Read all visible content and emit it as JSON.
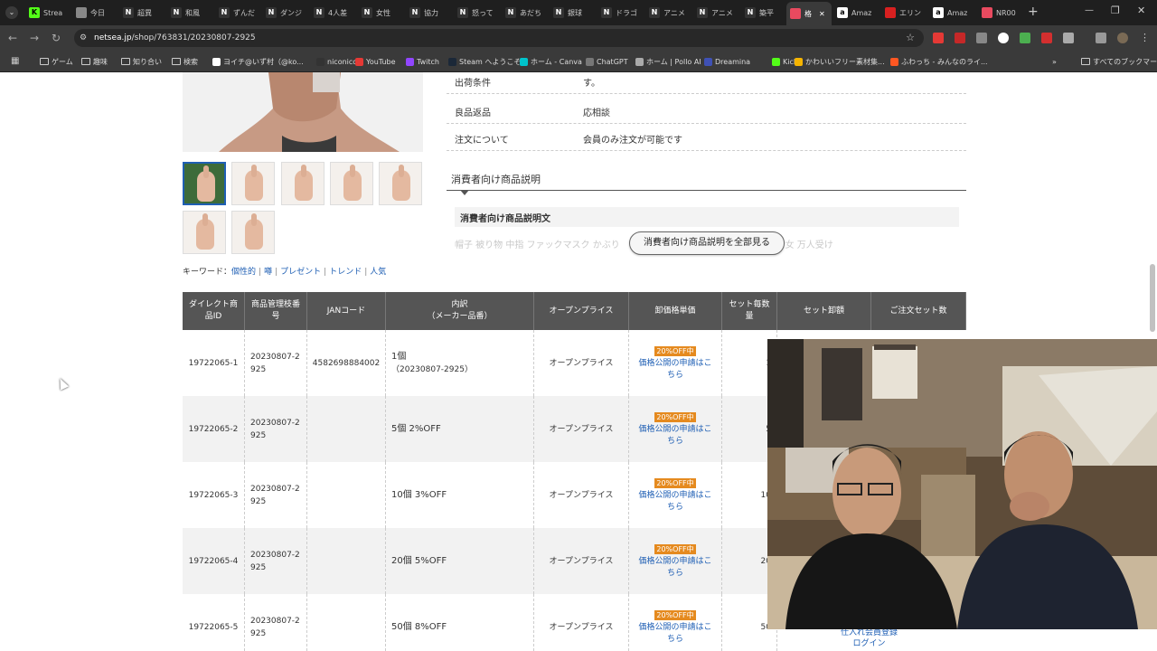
{
  "browser": {
    "tabs": [
      {
        "label": "Strea",
        "icon": "kick-icon",
        "color": "#53fc18"
      },
      {
        "label": "今日",
        "icon": "globe-icon",
        "color": "#888888"
      },
      {
        "label": "超異",
        "icon": "n-icon",
        "color": "#333333"
      },
      {
        "label": "和風",
        "icon": "n-icon",
        "color": "#333333"
      },
      {
        "label": "ずんだ",
        "icon": "n-icon",
        "color": "#333333"
      },
      {
        "label": "ダンジ",
        "icon": "n-icon",
        "color": "#333333"
      },
      {
        "label": "4人差",
        "icon": "n-icon",
        "color": "#333333"
      },
      {
        "label": "女性",
        "icon": "n-icon",
        "color": "#333333"
      },
      {
        "label": "協力",
        "icon": "n-icon",
        "color": "#333333"
      },
      {
        "label": "怒って",
        "icon": "n-icon",
        "color": "#333333"
      },
      {
        "label": "あだち",
        "icon": "n-icon",
        "color": "#333333"
      },
      {
        "label": "銀球",
        "icon": "n-icon",
        "color": "#333333"
      },
      {
        "label": "ドラゴ",
        "icon": "n-icon",
        "color": "#333333"
      },
      {
        "label": "アニメ",
        "icon": "n-icon",
        "color": "#333333"
      },
      {
        "label": "アニメ",
        "icon": "n-icon",
        "color": "#333333"
      },
      {
        "label": "築平",
        "icon": "n-icon",
        "color": "#333333"
      },
      {
        "label": "格",
        "icon": "chart-icon",
        "color": "#e84a5f",
        "active": true
      },
      {
        "label": "Amaz",
        "icon": "a-icon",
        "color": "#ffffff"
      },
      {
        "label": "エリン",
        "icon": "circle-icon",
        "color": "#d82020"
      },
      {
        "label": "Amaz",
        "icon": "a-icon",
        "color": "#ffffff"
      },
      {
        "label": "NR00",
        "icon": "nr-icon",
        "color": "#e84a5f"
      }
    ],
    "url": {
      "domain": "netsea.jp",
      "path": "/shop/763831/20230807-2925"
    },
    "bookmarks": [
      {
        "label": "ゲーム",
        "icon": "folder-icon"
      },
      {
        "label": "趣味",
        "icon": "folder-icon"
      },
      {
        "label": "知り合い",
        "icon": "folder-icon"
      },
      {
        "label": "検索",
        "icon": "folder-icon"
      },
      {
        "label": "ヨイチ@いず村（@ko...",
        "icon": "x-icon"
      },
      {
        "label": "niconico",
        "icon": "niconico-icon"
      },
      {
        "label": "YouTube",
        "icon": "youtube-icon"
      },
      {
        "label": "Twitch",
        "icon": "twitch-icon"
      },
      {
        "label": "Steam へようこそ",
        "icon": "steam-icon"
      },
      {
        "label": "ホーム - Canva",
        "icon": "canva-icon"
      },
      {
        "label": "ChatGPT",
        "icon": "chatgpt-icon"
      },
      {
        "label": "ホーム | Pollo AI",
        "icon": "pollo-icon"
      },
      {
        "label": "Dreamina",
        "icon": "dreamina-icon"
      },
      {
        "label": "Kick",
        "icon": "kick-icon"
      },
      {
        "label": "かわいいフリー素材集...",
        "icon": "irasutoya-icon"
      },
      {
        "label": "ふわっち - みんなのライ...",
        "icon": "fuwacchi-icon"
      }
    ],
    "more_bookmarks": "»",
    "all_bookmarks": "すべてのブックマーク"
  },
  "details": {
    "rows": [
      {
        "key": "出荷条件",
        "value": "す。"
      },
      {
        "key": "良品返品",
        "value": "応相談"
      },
      {
        "key": "注文について",
        "value": "会員のみ注文が可能です"
      }
    ]
  },
  "consumer_section": {
    "title": "消費者向け商品説明",
    "box_title": "消費者向け商品説明文",
    "faded_text_left": "帽子 被り物 中指 ファックマスク かぶり",
    "faded_text_right": "テム 老若男女 万人受け",
    "show_all_button": "消費者向け商品説明を全部見る"
  },
  "keywords": {
    "label": "キーワード：",
    "items": [
      "個性的",
      "噂",
      "プレゼント",
      "トレンド",
      "人気"
    ]
  },
  "table": {
    "headers": [
      "ダイレクト商品ID",
      "商品管理枝番号",
      "JANコード",
      "内訳\n（メーカー品番）",
      "オープンプライス",
      "卸価格単価",
      "セット毎数量",
      "セット卸額",
      "ご注文セット数"
    ],
    "badge": "20%OFF中",
    "price_link": "価格公開の申請はこちら",
    "rows": [
      {
        "id": "19722065-1",
        "branch": "20230807-2925",
        "jan": "4582698884002",
        "detail": "1個",
        "detail_sub": "（20230807-2925）",
        "open": "オープンプライス",
        "qty": "1"
      },
      {
        "id": "19722065-2",
        "branch": "20230807-2925",
        "jan": "",
        "detail": "5個 2%OFF",
        "detail_sub": "",
        "open": "オープンプライス",
        "qty": "5"
      },
      {
        "id": "19722065-3",
        "branch": "20230807-2925",
        "jan": "",
        "detail": "10個 3%OFF",
        "detail_sub": "",
        "open": "オープンプライス",
        "qty": "10"
      },
      {
        "id": "19722065-4",
        "branch": "20230807-2925",
        "jan": "",
        "detail": "20個 5%OFF",
        "detail_sub": "",
        "open": "オープンプライス",
        "qty": "20"
      },
      {
        "id": "19722065-5",
        "branch": "20230807-2925",
        "jan": "",
        "detail": "50個 8%OFF",
        "detail_sub": "",
        "open": "オープンプライス",
        "qty": "50"
      }
    ],
    "footer_links": [
      "仕入れ会員登録",
      "ログイン"
    ]
  }
}
